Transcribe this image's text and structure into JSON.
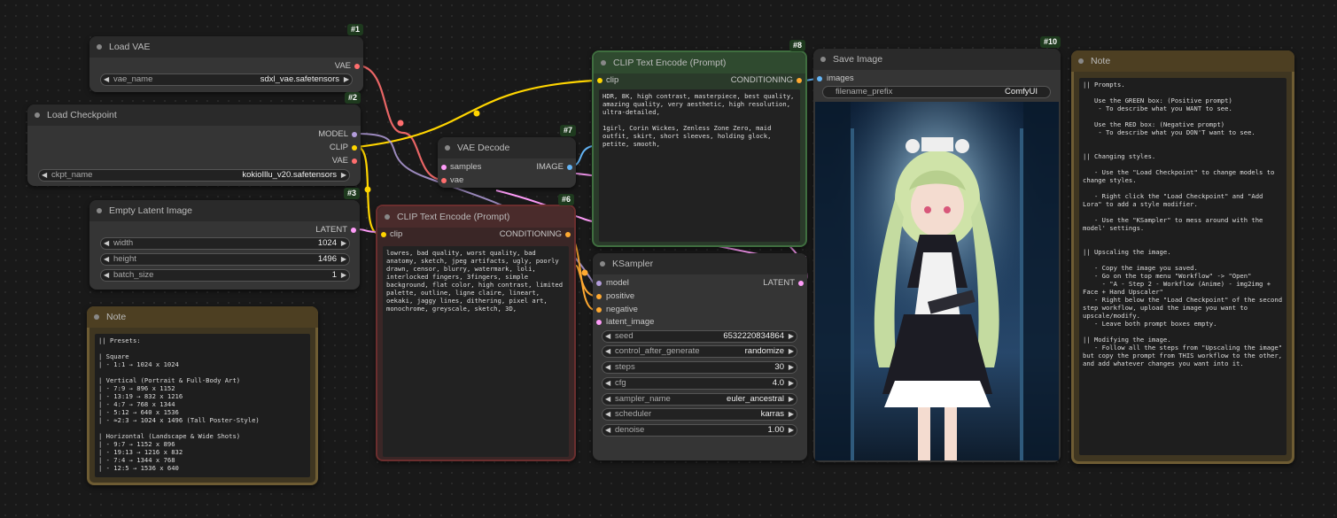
{
  "nodes": {
    "load_vae": {
      "title": "Load VAE",
      "badge": "#1",
      "output": "VAE",
      "widget_label": "vae_name",
      "widget_value": "sdxl_vae.safetensors"
    },
    "load_checkpoint": {
      "title": "Load Checkpoint",
      "badge": "#2",
      "outputs": [
        "MODEL",
        "CLIP",
        "VAE"
      ],
      "widget_label": "ckpt_name",
      "widget_value": "kokioIllu_v20.safetensors"
    },
    "empty_latent": {
      "title": "Empty Latent Image",
      "badge": "#3",
      "output": "LATENT",
      "widgets": [
        {
          "label": "width",
          "value": "1024"
        },
        {
          "label": "height",
          "value": "1496"
        },
        {
          "label": "batch_size",
          "value": "1"
        }
      ]
    },
    "note_presets": {
      "title": "Note",
      "text": "|| Presets:\n\n| Square\n| - 1:1 → 1024 x 1024\n\n| Vertical (Portrait & Full-Body Art)\n| - 7:9 → 896 x 1152\n| - 13:19 → 832 x 1216\n| - 4:7 → 768 x 1344\n| - 5:12 → 640 x 1536\n| - ≈2:3 → 1024 x 1496 (Tall Poster-Style)\n\n| Horizontal (Landscape & Wide Shots)\n| - 9:7 → 1152 x 896\n| - 19:13 → 1216 x 832\n| - 7:4 → 1344 x 768\n| - 12:5 → 1536 x 640"
    },
    "vae_decode": {
      "title": "VAE Decode",
      "badge": "#7",
      "inputs": [
        "samples",
        "vae"
      ],
      "output": "IMAGE"
    },
    "clip_neg": {
      "title": "CLIP Text Encode (Prompt)",
      "badge": "#6",
      "input": "clip",
      "output": "CONDITIONING",
      "text": "lowres, bad quality, worst quality, bad anatomy, sketch, jpeg artifacts, ugly, poorly drawn, censor, blurry, watermark, loli, interlocked fingers, 3fingers, simple background, flat color, high contrast, limited palette, outline, ligne claire, lineart, oekaki, jaggy lines, dithering, pixel art, monochrome, greyscale, sketch, 3D,"
    },
    "clip_pos": {
      "title": "CLIP Text Encode (Prompt)",
      "badge": "#8",
      "input": "clip",
      "output": "CONDITIONING",
      "text": "HDR, 8K, high contrast, masterpiece, best quality, amazing quality, very aesthetic, high resolution, ultra-detailed,\n\n1girl, Corin Wickes, Zenless Zone Zero, maid outfit, skirt, short sleeves, holding glock, petite, smooth,"
    },
    "ksampler": {
      "title": "KSampler",
      "inputs": [
        "model",
        "positive",
        "negative",
        "latent_image"
      ],
      "output": "LATENT",
      "widgets": [
        {
          "label": "seed",
          "value": "653222083486​4"
        },
        {
          "label": "control_after_generate",
          "value": "randomize"
        },
        {
          "label": "steps",
          "value": "30"
        },
        {
          "label": "cfg",
          "value": "4.0"
        },
        {
          "label": "sampler_name",
          "value": "euler_ancestral"
        },
        {
          "label": "scheduler",
          "value": "karras"
        },
        {
          "label": "denoise",
          "value": "1.00"
        }
      ]
    },
    "save_image": {
      "title": "Save Image",
      "badge": "#10",
      "input": "images",
      "widget_label": "filename_prefix",
      "widget_value": "ComfyUI"
    },
    "note_help": {
      "title": "Note",
      "text": "|| Prompts.\n\n   Use the GREEN box: (Positive prompt)\n    - To describe what you WANT to see.\n\n   Use the RED box: (Negative prompt)\n    - To describe what you DON'T want to see.\n\n\n|| Changing styles.\n\n   - Use the \"Load Checkpoint\" to change models to change styles.\n\n   - Right click the \"Load Checkpoint\" and \"Add Lora\" to add a style modifier.\n\n   - Use the \"KSampler\" to mess around with the model' settings.\n\n\n|| Upscaling the image.\n\n   - Copy the image you saved.\n   - Go on the top menu \"Workflow\" -> \"Open\"\n     - \"A - Step 2 - Workflow (Anime) - img2img + Face + Hand Upscaler\"\n   - Right below the \"Load Checkpoint\" of the second step workflow, upload the image you want to upscale/modify.\n   - Leave both prompt boxes empty.\n\n|| Modifying the image.\n   - Follow all the steps from \"Upscaling the image\" but copy the prompt from THIS workflow to the other, and add whatever changes you want into it."
    }
  },
  "colors": {
    "clip": "#ffd500",
    "vae": "#ff6e6e",
    "model": "#b39ddb",
    "latent": "#ff9cf9",
    "image": "#64b5f6",
    "conditioning": "#ffa931"
  }
}
